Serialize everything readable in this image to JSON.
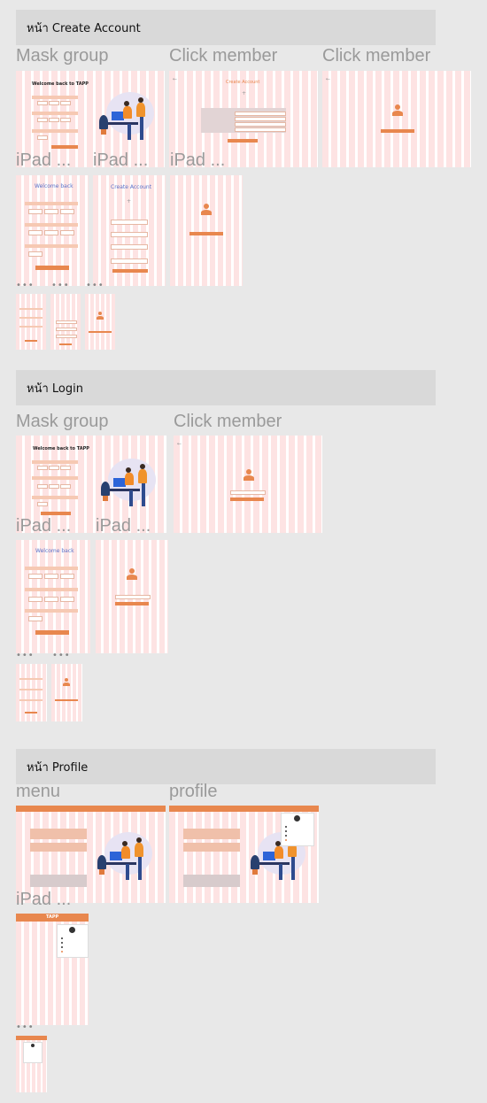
{
  "sections": {
    "create": "หน้า Create Account",
    "login": "หน้า Login",
    "profile": "หน้า Profile"
  },
  "frame_labels": {
    "mask_group": "Mask group",
    "click_member": "Click member",
    "ipad": "iPad ...",
    "menu": "menu",
    "profile": "profile"
  },
  "content": {
    "welcome_tapp": "Welcome back to TAPP",
    "welcome_back": "Welcome back",
    "create_account": "Create Account",
    "tapp": "TAPP",
    "ellipsis": "•••"
  },
  "colors": {
    "accent": "#e8874e",
    "stripe": "#fde3e3",
    "title_blue": "#5b72c9",
    "header_bg": "#d9d9d9",
    "canvas_bg": "#e8e8e8"
  }
}
